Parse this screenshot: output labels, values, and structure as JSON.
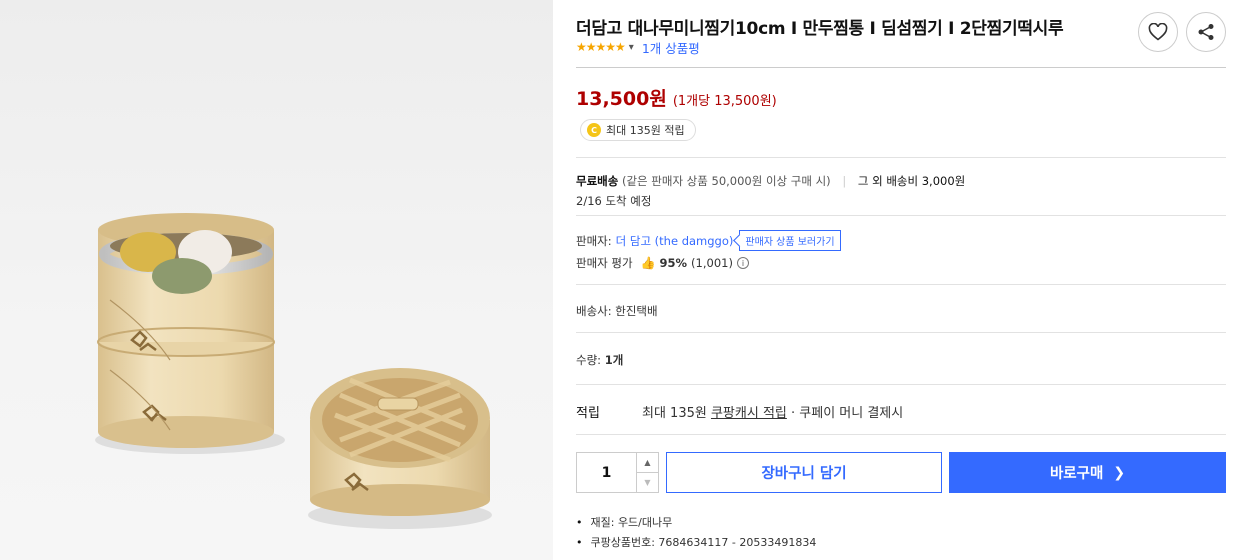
{
  "product": {
    "title": "더담고 대나무미니찜기10cm I 만두찜통 I 딤섬찜기 I 2단찜기떡시루",
    "rating_stars": "★★★★★",
    "review_count": "1개 상품평"
  },
  "price": {
    "main": "13,500원",
    "unit": "(1개당 13,500원)"
  },
  "cash_badge": {
    "coin": "C",
    "text": "최대 135원 적립"
  },
  "shipping": {
    "free_label": "무료배송",
    "condition": "(같은 판매자 상품 50,000원 이상 구매 시)",
    "other": "그 외 배송비 3,000원",
    "arrival": "2/16 도착 예정"
  },
  "seller": {
    "label": "판매자:",
    "name": "더 담고 (the damggo)",
    "tooltip": "판매자 상품 보러가기",
    "rating_label": "판매자 평가",
    "rating_pct": "95%",
    "rating_count": "(1,001)"
  },
  "courier": "배송사: 한진택배",
  "quantity": {
    "label": "수량:",
    "value_text": "1개",
    "stepper_value": "1"
  },
  "points": {
    "label": "적립",
    "prefix": "최대 135원 ",
    "link": "쿠팡캐시 적립",
    "suffix": " · 쿠페이 머니 결제시"
  },
  "buttons": {
    "cart": "장바구니 담기",
    "buy": "바로구매"
  },
  "details": [
    "재질: 우드/대나무",
    "쿠팡상품번호: 7684634117 - 20533491834"
  ],
  "colors": {
    "accent": "#346aff",
    "price": "#ae0000",
    "star": "#f6a500"
  },
  "icons": [
    "heart-icon",
    "share-icon",
    "chevron-down-icon",
    "thumb-up-icon",
    "info-icon",
    "chevron-right-icon",
    "arrow-up-icon",
    "arrow-down-icon"
  ]
}
